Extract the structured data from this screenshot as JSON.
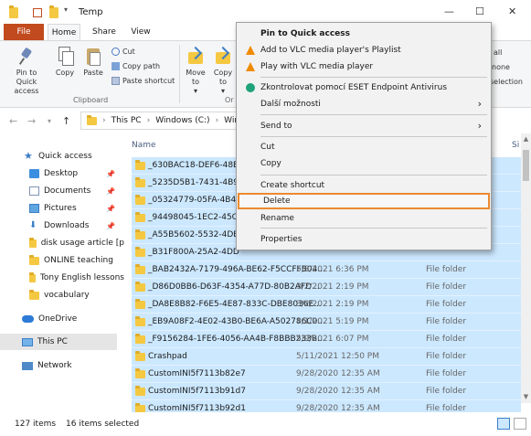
{
  "window": {
    "title": "Temp",
    "controls": {
      "minimize": "—",
      "maximize": "☐",
      "close": "✕"
    }
  },
  "ribbon_tabs": [
    "File",
    "Home",
    "Share",
    "View"
  ],
  "ribbon": {
    "pin_to_quick_access": "Pin to Quick access",
    "copy": "Copy",
    "paste": "Paste",
    "cut": "Cut",
    "copy_path": "Copy path",
    "paste_shortcut": "Paste shortcut",
    "clipboard_group": "Clipboard",
    "move_to": "Move to",
    "copy_to": "Copy to",
    "organize_partial": "Or",
    "right_all": "all",
    "right_none": "none",
    "right_selection": "selection"
  },
  "address": {
    "crumbs": [
      "This PC",
      "Windows (C:)",
      "Win"
    ]
  },
  "sidebar": {
    "items": [
      {
        "label": "Quick access",
        "icon": "star-icon"
      },
      {
        "label": "Desktop",
        "icon": "desktop-icon",
        "pinned": true
      },
      {
        "label": "Documents",
        "icon": "documents-icon",
        "pinned": true
      },
      {
        "label": "Pictures",
        "icon": "pictures-icon",
        "pinned": true
      },
      {
        "label": "Downloads",
        "icon": "downloads-icon",
        "pinned": true
      },
      {
        "label": "disk usage article [p",
        "icon": "folder-icon"
      },
      {
        "label": "ONLINE teaching",
        "icon": "folder-icon"
      },
      {
        "label": "Tony English lessons",
        "icon": "folder-icon"
      },
      {
        "label": "vocabulary",
        "icon": "folder-icon"
      },
      {
        "label": "OneDrive",
        "icon": "onedrive-icon"
      },
      {
        "label": "This PC",
        "icon": "this-pc-icon"
      },
      {
        "label": "Network",
        "icon": "network-icon"
      }
    ]
  },
  "filelist": {
    "columns": {
      "name": "Name",
      "size_partial": "Si"
    },
    "rows": [
      {
        "name": "_630BAC18-DEF6-48E0",
        "date": "",
        "type": ""
      },
      {
        "name": "_5235D5B1-7431-4B96",
        "date": "",
        "type": ""
      },
      {
        "name": "_05324779-05FA-4B4E",
        "date": "",
        "type": ""
      },
      {
        "name": "_94498045-1EC2-45C3",
        "date": "",
        "type": ""
      },
      {
        "name": "_A55B5602-5532-4DEF",
        "date": "",
        "type": ""
      },
      {
        "name": "_B31F800A-25A2-4DD",
        "date": "",
        "type": ""
      },
      {
        "name": "_BAB2432A-7179-496A-BE62-F5CCFFB04...",
        "date": "5/8/2021 6:36 PM",
        "type": "File folder"
      },
      {
        "name": "_D86D0BB6-D63F-4354-A77D-80B2AFD...",
        "date": "3/2/2021 2:19 PM",
        "type": "File folder"
      },
      {
        "name": "_DA8E8B82-F6E5-4E87-833C-DBE8036E...",
        "date": "3/2/2021 2:19 PM",
        "type": "File folder"
      },
      {
        "name": "_EB9A08F2-4E02-43B0-BE6A-A502786C0...",
        "date": "4/1/2021 5:19 PM",
        "type": "File folder"
      },
      {
        "name": "_F9156284-1FE6-4056-AA4B-F8BBB233B...",
        "date": "5/9/2021 6:07 PM",
        "type": "File folder"
      },
      {
        "name": "Crashpad",
        "date": "5/11/2021 12:50 PM",
        "type": "File folder"
      },
      {
        "name": "CustomINI5f7113b82e7",
        "date": "9/28/2020 12:35 AM",
        "type": "File folder"
      },
      {
        "name": "CustomINI5f7113b91d7",
        "date": "9/28/2020 12:35 AM",
        "type": "File folder"
      },
      {
        "name": "CustomINI5f7113b92d1",
        "date": "9/28/2020 12:35 AM",
        "type": "File folder"
      },
      {
        "name": "CustomINI5f7113b825a",
        "date": "9/28/2020 12:35 AM",
        "type": "File folder"
      }
    ]
  },
  "context_menu": {
    "pin_to_quick_access": "Pin to Quick access",
    "add_vlc_playlist": "Add to VLC media player's Playlist",
    "play_vlc": "Play with VLC media player",
    "eset_scan": "Zkontrolovat pomocí ESET Endpoint Antivirus",
    "more_options": "Další možnosti",
    "send_to": "Send to",
    "cut": "Cut",
    "copy": "Copy",
    "create_shortcut": "Create shortcut",
    "delete": "Delete",
    "rename": "Rename",
    "properties": "Properties",
    "submenu_arrow": "›"
  },
  "status": {
    "item_count": "127 items",
    "selected": "16 items selected"
  },
  "colors": {
    "file_tab": "#c14a1e",
    "selection": "#cce8ff",
    "delete_highlight_border": "#ec8a2f",
    "menu_bg": "#f2f2f2"
  }
}
